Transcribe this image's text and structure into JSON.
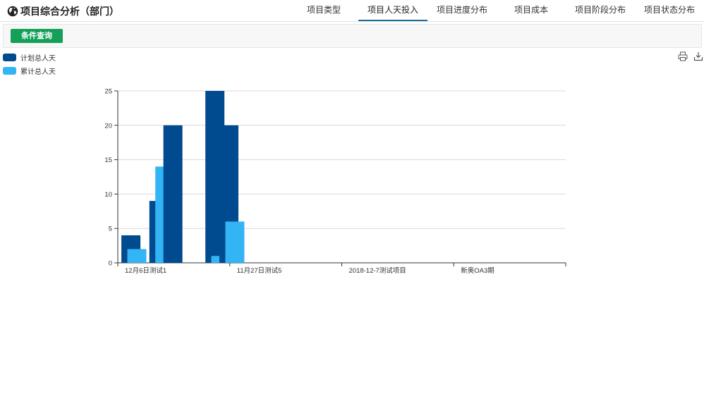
{
  "header": {
    "title": "项目综合分析（部门）",
    "tabs": [
      {
        "label": "项目类型",
        "active": false
      },
      {
        "label": "项目人天投入",
        "active": true
      },
      {
        "label": "项目进度分布",
        "active": false
      },
      {
        "label": "项目成本",
        "active": false
      },
      {
        "label": "项目阶段分布",
        "active": false
      },
      {
        "label": "项目状态分布",
        "active": false
      }
    ]
  },
  "toolbar": {
    "query_label": "条件查询",
    "icons": [
      "print-icon",
      "download-icon"
    ]
  },
  "colors": {
    "series_1": "#004a8f",
    "series_2": "#33b5f5",
    "query_button": "#15a05a",
    "active_tab": "#1e6b9e"
  },
  "chart_data": {
    "type": "bar",
    "categories": [
      "12月6日测试1",
      "11月27日测试5",
      "2018-12-7测试项目",
      "新奥OA3期"
    ],
    "series": [
      {
        "name": "计划总人天",
        "color": "#004a8f"
      },
      {
        "name": "累计总人天",
        "color": "#33b5f5"
      }
    ],
    "bars": [
      {
        "x": 0.117,
        "series": 0,
        "value": 4
      },
      {
        "x": 0.17,
        "series": 1,
        "value": 2
      },
      {
        "x": 0.367,
        "series": 0,
        "value": 9
      },
      {
        "x": 0.42,
        "series": 1,
        "value": 14
      },
      {
        "x": 0.492,
        "series": 0,
        "value": 20
      },
      {
        "x": 0.867,
        "series": 0,
        "value": 25
      },
      {
        "x": 0.92,
        "series": 1,
        "value": 1
      },
      {
        "x": 0.992,
        "series": 0,
        "value": 20
      },
      {
        "x": 1.045,
        "series": 1,
        "value": 6
      }
    ],
    "yticks": [
      0,
      5,
      10,
      15,
      20,
      25
    ],
    "ylim": [
      0,
      25
    ],
    "grid": true,
    "legend_position": "top-left",
    "title": "",
    "xlabel": "",
    "ylabel": ""
  }
}
